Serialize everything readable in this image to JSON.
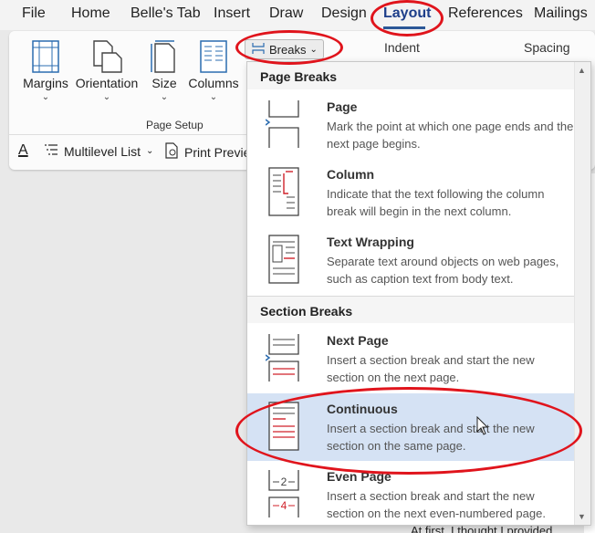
{
  "menu_tabs": [
    "File",
    "Home",
    "Belle's Tab",
    "Insert",
    "Draw",
    "Design",
    "Layout",
    "References",
    "Mailings"
  ],
  "active_tab": "Layout",
  "ribbon": {
    "buttons": [
      "Margins",
      "Orientation",
      "Size",
      "Columns"
    ],
    "group_label": "Page Setup",
    "breaks_label": "Breaks",
    "indent_label": "Indent",
    "spacing_label": "Spacing",
    "multilevel_label": "Multilevel List",
    "print_preview_label": "Print Previe"
  },
  "breaks_menu": {
    "page_breaks_header": "Page Breaks",
    "section_breaks_header": "Section Breaks",
    "items": [
      {
        "title": "Page",
        "description": "Mark the point at which one page ends and the next page begins.",
        "icon": "page-break-icon"
      },
      {
        "title": "Column",
        "description": "Indicate that the text following the column break will begin in the next column.",
        "icon": "column-break-icon"
      },
      {
        "title": "Text Wrapping",
        "description": "Separate text around objects on web pages, such as caption text from body text.",
        "icon": "text-wrapping-icon"
      },
      {
        "title": "Next Page",
        "description": "Insert a section break and start the new section on the next page.",
        "icon": "next-page-icon"
      },
      {
        "title": "Continuous",
        "description": "Insert a section break and start the new section on the same page.",
        "icon": "continuous-icon"
      },
      {
        "title": "Even Page",
        "description": "Insert a section break and start the new section on the next even-numbered page.",
        "icon": "even-page-icon"
      }
    ]
  },
  "document_text": "At first, I thought I provided",
  "colors": {
    "accent": "#2b5797",
    "annotation": "#e0141c",
    "highlight": "#d5e2f4"
  }
}
